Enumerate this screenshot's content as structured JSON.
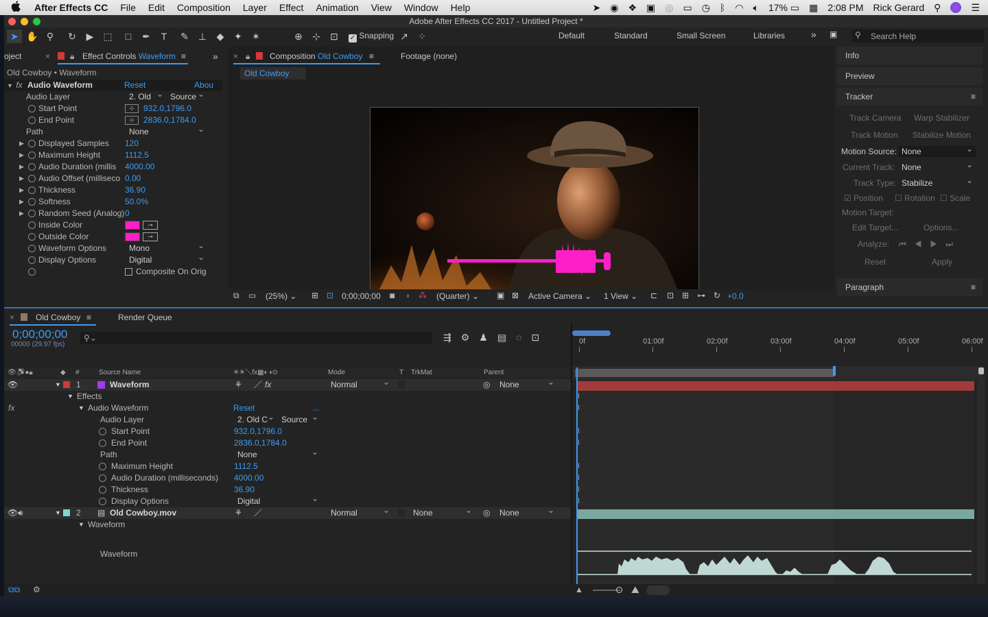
{
  "menubar": {
    "apple": "",
    "app_name": "After Effects CC",
    "items": [
      "File",
      "Edit",
      "Composition",
      "Layer",
      "Effect",
      "Animation",
      "View",
      "Window",
      "Help"
    ],
    "battery": "17%",
    "clock": "2:08 PM",
    "user": "Rick Gerard"
  },
  "window": {
    "title": "Adobe After Effects CC 2017 - Untitled Project *"
  },
  "toolbar": {
    "snapping_label": "Snapping",
    "workspaces": [
      "Default",
      "Standard",
      "Small Screen",
      "Libraries"
    ],
    "more": "»",
    "search_placeholder": "Search Help"
  },
  "project_tab": "oject",
  "effect_controls": {
    "tab_prefix": "Effect Controls ",
    "tab_name": "Waveform",
    "breadcrumb": "Old Cowboy • Waveform",
    "fx_label": "fx",
    "effect_name": "Audio Waveform",
    "reset": "Reset",
    "about": "Abou",
    "rows": [
      {
        "label": "Audio Layer",
        "value": "2. Old",
        "value2": "Source"
      },
      {
        "label": "Start Point",
        "value": "932.0,1796.0"
      },
      {
        "label": "End Point",
        "value": "2836.0,1784.0"
      },
      {
        "label": "Path",
        "value": "None"
      },
      {
        "label": "Displayed Samples",
        "value": "120"
      },
      {
        "label": "Maximum Height",
        "value": "1112.5"
      },
      {
        "label": "Audio Duration (millis",
        "value": "4000.00"
      },
      {
        "label": "Audio Offset (milliseco",
        "value": "0.00"
      },
      {
        "label": "Thickness",
        "value": "36.90"
      },
      {
        "label": "Softness",
        "value": "50.0%"
      },
      {
        "label": "Random Seed (Analog)",
        "value": "0"
      },
      {
        "label": "Inside Color",
        "value": ""
      },
      {
        "label": "Outside Color",
        "value": ""
      },
      {
        "label": "Waveform Options",
        "value": "Mono"
      },
      {
        "label": "Display Options",
        "value": "Digital"
      },
      {
        "label": "",
        "value": "Composite On Orig"
      }
    ],
    "color_swatch": "#ff1fc8"
  },
  "composition": {
    "tab_prefix": "Composition ",
    "tab_name": "Old Cowboy",
    "footage_tab": "Footage (none)",
    "subtab": "Old Cowboy",
    "zoom": "(25%)",
    "timecode": "0;00;00;00",
    "resolution": "(Quarter)",
    "camera": "Active Camera",
    "views": "1 View",
    "exposure": "+0.0"
  },
  "right_panel": {
    "info": "Info",
    "preview": "Preview",
    "tracker": "Tracker",
    "track_camera": "Track Camera",
    "warp_stabilizer": "Warp Stabilizer",
    "track_motion": "Track Motion",
    "stabilize_motion": "Stabilize Motion",
    "motion_source_label": "Motion Source:",
    "motion_source_value": "None",
    "current_track_label": "Current Track:",
    "current_track_value": "None",
    "track_type_label": "Track Type:",
    "track_type_value": "Stabilize",
    "position": "Position",
    "rotation": "Rotation",
    "scale": "Scale",
    "motion_target": "Motion Target:",
    "edit_target": "Edit Target...",
    "options": "Options...",
    "analyze": "Analyze:",
    "reset": "Reset",
    "apply": "Apply",
    "paragraph": "Paragraph"
  },
  "timeline": {
    "tab_name": "Old Cowboy",
    "render_queue": "Render Queue",
    "timecode": "0;00;00;00",
    "frames": "00000 (29.97 fps)",
    "col_num": "#",
    "col_source": "Source Name",
    "col_mode": "Mode",
    "col_t": "T",
    "col_trkmat": "TrkMat",
    "col_parent": "Parent",
    "ruler": [
      "0f",
      "01:00f",
      "02:00f",
      "03:00f",
      "04:00f",
      "05:00f",
      "06:00f"
    ],
    "layers": [
      {
        "num": "1",
        "name": "Waveform",
        "color": "#9e3bf5",
        "mode": "Normal",
        "trkmat": "",
        "parent": "None"
      },
      {
        "num": "2",
        "name": "Old Cowboy.mov",
        "color": "#7fd6d0",
        "mode": "Normal",
        "trkmat": "None",
        "parent": "None"
      }
    ],
    "effects": "Effects",
    "fx_label": "fx",
    "effect_name": "Audio Waveform",
    "reset": "Reset",
    "reset_more": "...",
    "props": [
      {
        "label": "Audio Layer",
        "value": "2. Old C",
        "value2": "Source"
      },
      {
        "label": "Start Point",
        "value": "932.0,1796.0"
      },
      {
        "label": "End Point",
        "value": "2836.0,1784.0"
      },
      {
        "label": "Path",
        "value": "None"
      },
      {
        "label": "Maximum Height",
        "value": "1112.5"
      },
      {
        "label": "Audio Duration (milliseconds)",
        "value": "4000.00"
      },
      {
        "label": "Thickness",
        "value": "36.90"
      },
      {
        "label": "Display Options",
        "value": "Digital"
      }
    ],
    "waveform_group": "Waveform",
    "waveform_label": "Waveform"
  }
}
